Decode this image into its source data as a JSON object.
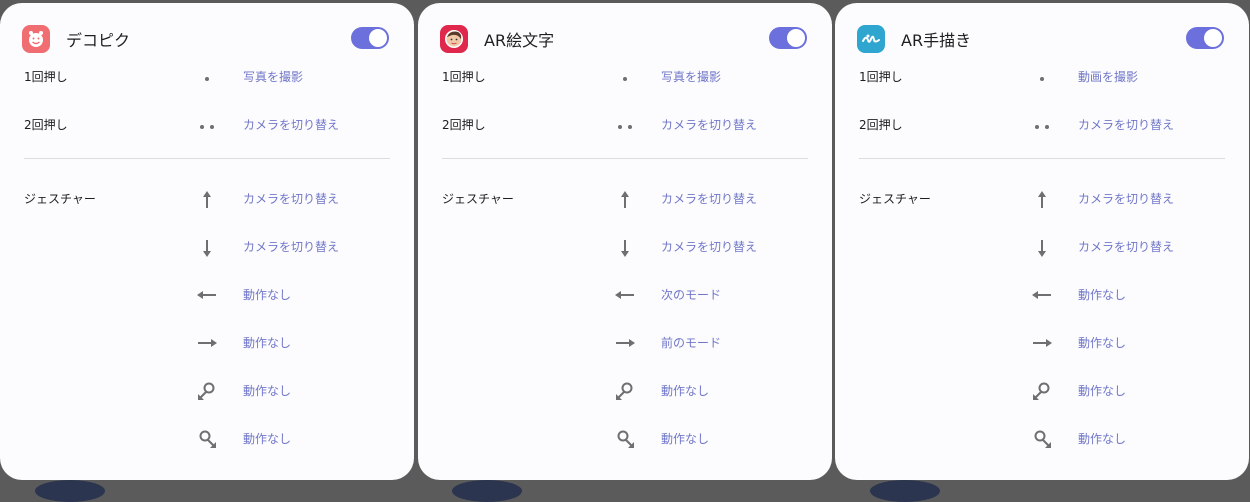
{
  "cards": [
    {
      "title": "デコピク",
      "icon": "decopic-app-icon",
      "icon_color": "#f06d72",
      "toggle_on": true,
      "rows": [
        {
          "label": "1回押し",
          "icon": "dot-icon",
          "action": "写真を撮影"
        },
        {
          "label": "2回押し",
          "icon": "double-dot-icon",
          "action": "カメラを切り替え"
        },
        {
          "label": "ジェスチャー",
          "icon": "arrow-up-icon",
          "action": "カメラを切り替え"
        },
        {
          "label": "",
          "icon": "arrow-down-icon",
          "action": "カメラを切り替え"
        },
        {
          "label": "",
          "icon": "arrow-left-icon",
          "action": "動作なし"
        },
        {
          "label": "",
          "icon": "arrow-right-icon",
          "action": "動作なし"
        },
        {
          "label": "",
          "icon": "circle-ccw-icon",
          "action": "動作なし"
        },
        {
          "label": "",
          "icon": "circle-cw-icon",
          "action": "動作なし"
        }
      ]
    },
    {
      "title": "AR絵文字",
      "icon": "ar-emoji-app-icon",
      "icon_color": "#e0284c",
      "toggle_on": true,
      "rows": [
        {
          "label": "1回押し",
          "icon": "dot-icon",
          "action": "写真を撮影"
        },
        {
          "label": "2回押し",
          "icon": "double-dot-icon",
          "action": "カメラを切り替え"
        },
        {
          "label": "ジェスチャー",
          "icon": "arrow-up-icon",
          "action": "カメラを切り替え"
        },
        {
          "label": "",
          "icon": "arrow-down-icon",
          "action": "カメラを切り替え"
        },
        {
          "label": "",
          "icon": "arrow-left-icon",
          "action": "次のモード"
        },
        {
          "label": "",
          "icon": "arrow-right-icon",
          "action": "前のモード"
        },
        {
          "label": "",
          "icon": "circle-ccw-icon",
          "action": "動作なし"
        },
        {
          "label": "",
          "icon": "circle-cw-icon",
          "action": "動作なし"
        }
      ]
    },
    {
      "title": "AR手描き",
      "icon": "ar-doodle-app-icon",
      "icon_color": "#2ea6cf",
      "toggle_on": true,
      "rows": [
        {
          "label": "1回押し",
          "icon": "dot-icon",
          "action": "動画を撮影"
        },
        {
          "label": "2回押し",
          "icon": "double-dot-icon",
          "action": "カメラを切り替え"
        },
        {
          "label": "ジェスチャー",
          "icon": "arrow-up-icon",
          "action": "カメラを切り替え"
        },
        {
          "label": "",
          "icon": "arrow-down-icon",
          "action": "カメラを切り替え"
        },
        {
          "label": "",
          "icon": "arrow-left-icon",
          "action": "動作なし"
        },
        {
          "label": "",
          "icon": "arrow-right-icon",
          "action": "動作なし"
        },
        {
          "label": "",
          "icon": "circle-ccw-icon",
          "action": "動作なし"
        },
        {
          "label": "",
          "icon": "circle-cw-icon",
          "action": "動作なし"
        }
      ]
    }
  ],
  "colors": {
    "toggle_on": "#6c70dc",
    "action_text": "#7177c8",
    "background": "#5b5b5b"
  }
}
